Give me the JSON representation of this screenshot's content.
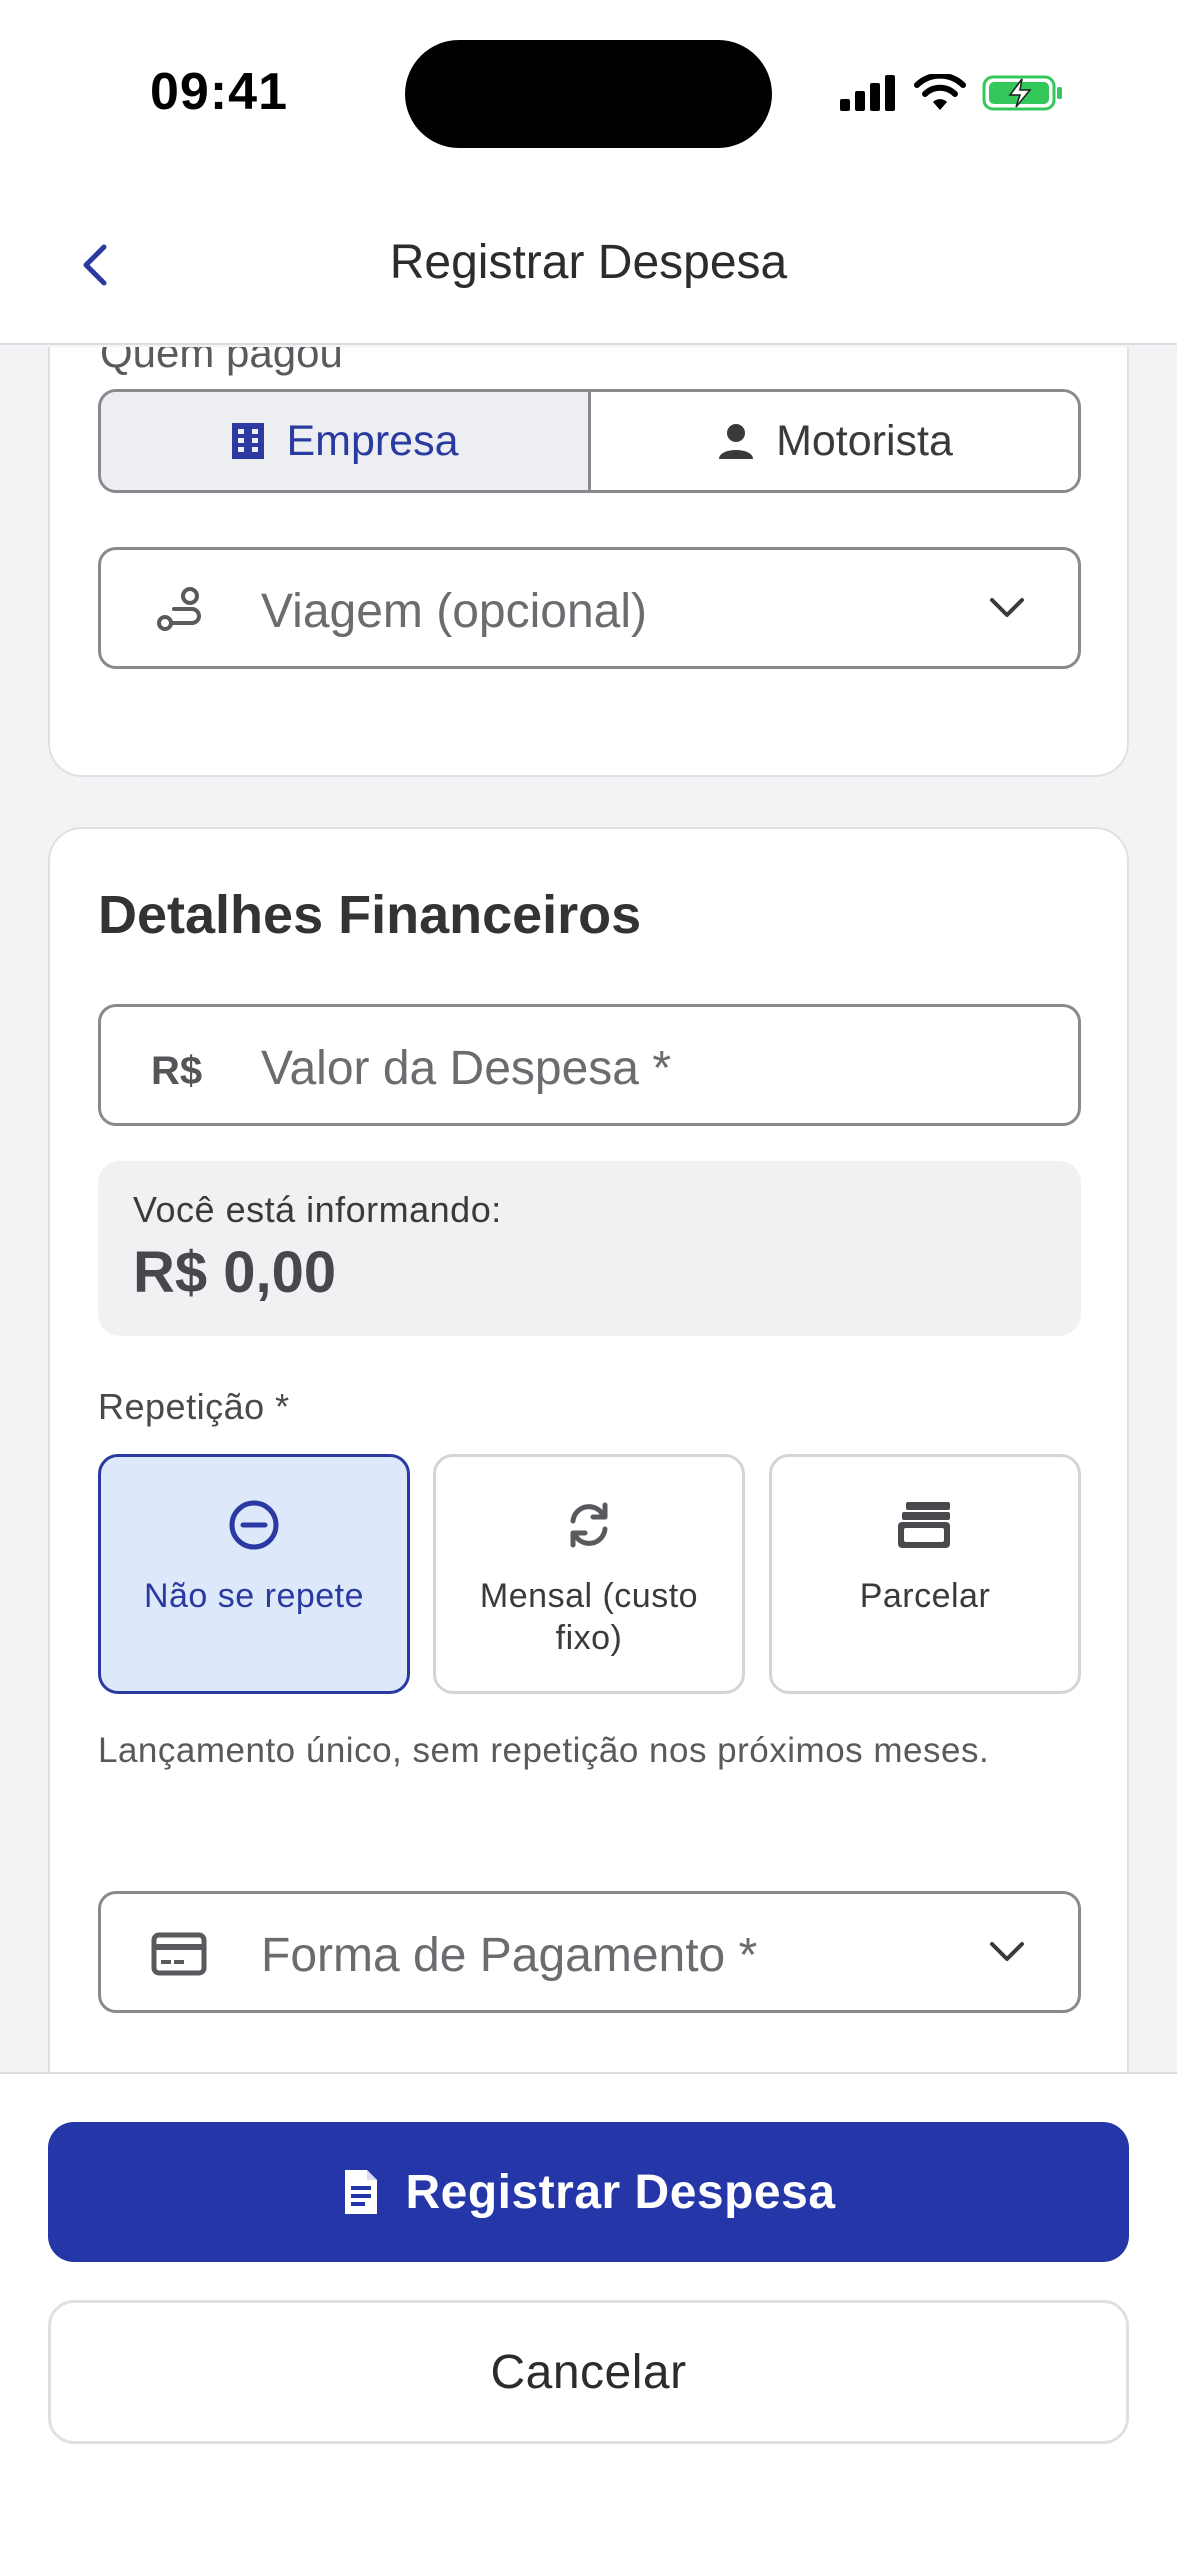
{
  "status_bar": {
    "time": "09:41"
  },
  "header": {
    "title": "Registrar Despesa"
  },
  "card1": {
    "cut_text": "Quem pagou",
    "payer_options": [
      {
        "label": "Empresa",
        "icon": "building-icon",
        "selected": true
      },
      {
        "label": "Motorista",
        "icon": "person-icon",
        "selected": false
      }
    ],
    "trip_placeholder": "Viagem (opcional)"
  },
  "financial": {
    "title": "Detalhes Financeiros",
    "currency_prefix": "R$",
    "amount_placeholder": "Valor da Despesa *",
    "info_label": "Você está informando:",
    "info_value": "R$ 0,00",
    "repetition_label": "Repetição *",
    "repetition_options": [
      {
        "label": "Não se repete",
        "icon": "minus-circle-icon",
        "selected": true
      },
      {
        "label": "Mensal (custo fixo)",
        "icon": "sync-icon",
        "selected": false
      },
      {
        "label": "Parcelar",
        "icon": "cards-stack-icon",
        "selected": false
      }
    ],
    "repetition_help": "Lançamento único, sem repetição nos próximos meses.",
    "payment_placeholder": "Forma de Pagamento *"
  },
  "footer": {
    "primary_label": "Registrar Despesa",
    "secondary_label": "Cancelar"
  },
  "colors": {
    "primary": "#2537a8",
    "accent_text": "#2a3aa0",
    "selected_bg": "#dde8fb",
    "page_bg": "#f2f3f5"
  }
}
